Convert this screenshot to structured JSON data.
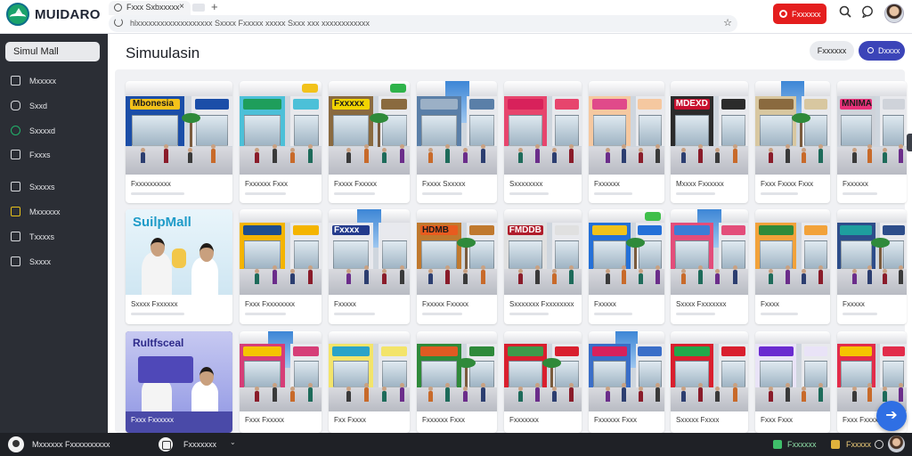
{
  "app": {
    "title": "MUIDARO"
  },
  "browser": {
    "tab_label": "Fxxx Sxbxxxxx",
    "tab_close": "×",
    "new_tab": "+",
    "url": "hlxxxxxxxxxxxxxxxxxxx Sxxxx Fxxxxx xxxxx Sxxx xxx xxxxxxxxxxxx",
    "star": "☆"
  },
  "header": {
    "record_label": "Fxxxxxx",
    "search_icon": "search-icon",
    "chat_icon": "chat-icon"
  },
  "sidebar": {
    "main": "Simul Mall",
    "items": [
      {
        "label": "Mxxxxx",
        "icon": "home-icon"
      },
      {
        "label": "Sxxd",
        "icon": "bag-icon"
      },
      {
        "label": "Sxxxxd",
        "icon": "cycle-icon"
      },
      {
        "label": "Fxxxs",
        "icon": "chart-icon"
      },
      {
        "label": "Sxxxxs",
        "icon": "store-icon"
      },
      {
        "label": "Mxxxxxx",
        "icon": "spark-icon"
      },
      {
        "label": "Txxxxs",
        "icon": "box-icon"
      },
      {
        "label": "Sxxxx",
        "icon": "square-icon"
      }
    ]
  },
  "main": {
    "title": "Simuulasin",
    "btn_light": "Fxxxxxx",
    "btn_blue": "Dxxxx"
  },
  "cards": [
    {
      "caption": "Fxxxxxxxxxx",
      "sign": "Mbonesia"
    },
    {
      "caption": "Fxxxxxx Fxxx",
      "sign": ""
    },
    {
      "caption": "Fxxxx Fxxxxx",
      "sign": "Fxxxxx"
    },
    {
      "caption": "Fxxxx Sxxxxx",
      "sign": ""
    },
    {
      "caption": "Sxxxxxxxx",
      "sign": ""
    },
    {
      "caption": "Fxxxxxx",
      "sign": ""
    },
    {
      "caption": "Mxxxx Fxxxxxx",
      "sign": "MDEXD"
    },
    {
      "caption": "Fxxx Fxxxx Fxxx",
      "sign": ""
    },
    {
      "caption": "Fxxxxxx",
      "sign": "MNIMA"
    },
    {
      "caption": "Sxxxx Fxxxxxx",
      "sign": "SuilpMall"
    },
    {
      "caption": "Fxxx Fxxxxxxxx",
      "sign": ""
    },
    {
      "caption": "Fxxxxx",
      "sign": "Fxxxx"
    },
    {
      "caption": "Fxxxxx Fxxxxx",
      "sign": "HDMB"
    },
    {
      "caption": "Sxxxxxxx Fxxxxxxxx",
      "sign": "FMDDB"
    },
    {
      "caption": "Fxxxxx",
      "sign": ""
    },
    {
      "caption": "Sxxxx Fxxxxxxx",
      "sign": ""
    },
    {
      "caption": "Fxxxx",
      "sign": ""
    },
    {
      "caption": "Fxxxxx",
      "sign": ""
    },
    {
      "caption": "Fxxx Fxxxxxx",
      "sign": "Rultfsceal"
    },
    {
      "caption": "Fxxx Fxxxxx",
      "sign": ""
    },
    {
      "caption": "Fxx Fxxxx",
      "sign": ""
    },
    {
      "caption": "Fxxxxxx Fxxx",
      "sign": ""
    },
    {
      "caption": "Fxxxxxxx",
      "sign": ""
    },
    {
      "caption": "Fxxxxxx Fxxx",
      "sign": ""
    },
    {
      "caption": "Sxxxxx Fxxxx",
      "sign": ""
    },
    {
      "caption": "Fxxx Fxxx",
      "sign": ""
    },
    {
      "caption": "Fxxx Fxxxx",
      "sign": ""
    }
  ],
  "taskbar": {
    "left_text": "Mxxxxxx Fxxxxxxxxxx",
    "mid_text": "Fxxxxxxx",
    "caret": "⌄",
    "right_green": "Fxxxxxx",
    "right_text": "Fxxxxx"
  },
  "fab_icon": "arrow-right-icon"
}
